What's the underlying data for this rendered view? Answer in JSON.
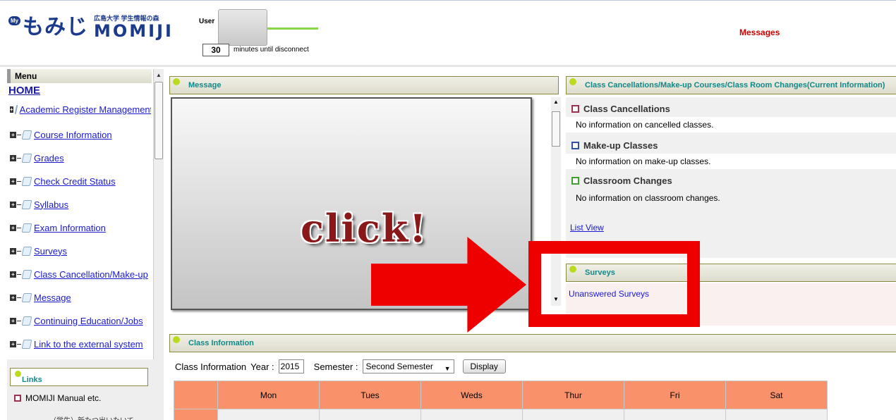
{
  "header": {
    "logo_badge": "My",
    "logo_jp": "もみじ",
    "logo_sub": "広島大学 学生情報の森",
    "logo_en": "MOMIJI",
    "user_label": "User",
    "timer_value": "30",
    "timer_label": "minutes until disconnect",
    "messages_link": "Messages"
  },
  "sidebar": {
    "menu_title": "Menu",
    "home": "HOME",
    "items": [
      {
        "label": "Academic Register Management"
      },
      {
        "label": "Course Information"
      },
      {
        "label": "Grades"
      },
      {
        "label": "Check Credit Status"
      },
      {
        "label": "Syllabus"
      },
      {
        "label": "Exam Information"
      },
      {
        "label": "Surveys"
      },
      {
        "label": "Class Cancellation/Make-up"
      },
      {
        "label": "Message"
      },
      {
        "label": "Continuing Education/Jobs"
      },
      {
        "label": "Link to the external system"
      }
    ],
    "links_title": "Links",
    "manual": "MOMIJI Manual etc.",
    "cut_text": "（学生）新たつ出いたいて"
  },
  "message_panel": {
    "title": "Message",
    "overlay_text": "click!"
  },
  "cancel_panel": {
    "title": "Class Cancellations/Make-up Courses/Class Room Changes(Current Information)",
    "sections": [
      {
        "heading": "Class Cancellations",
        "info": "No information on cancelled classes.",
        "color": "#a03050"
      },
      {
        "heading": "Make-up Classes",
        "info": "No information on make-up classes.",
        "color": "#3050a0"
      },
      {
        "heading": "Classroom Changes",
        "info": "No information on classroom changes.",
        "color": "#40a030"
      }
    ],
    "list_view": "List View"
  },
  "survey_panel": {
    "title": "Surveys",
    "unanswered": "Unanswered Surveys"
  },
  "class_info": {
    "title": "Class Information",
    "line_label": "Class Information",
    "year_label": "Year :",
    "year_value": "2015",
    "semester_label": "Semester :",
    "semester_value": "Second Semester",
    "display_button": "Display",
    "days": [
      "Mon",
      "Tues",
      "Weds",
      "Thur",
      "Fri",
      "Sat"
    ]
  },
  "colors": {
    "accent_red": "#ee0000",
    "link_blue": "#1a1ad0",
    "header_orange": "#f9926b",
    "teal_title": "#118888"
  }
}
